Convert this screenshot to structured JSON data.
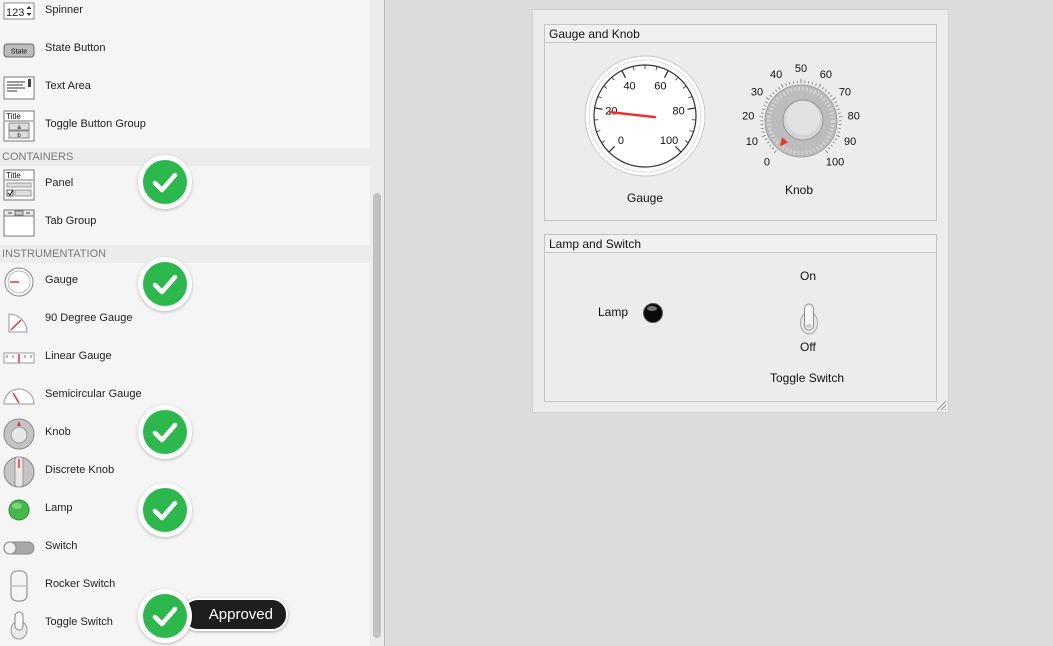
{
  "library": {
    "items_top": [
      {
        "label": "Spinner",
        "icon": "spinner-icon",
        "icon_text": "123"
      },
      {
        "label": "State Button",
        "icon": "state-button-icon",
        "icon_text": "State"
      },
      {
        "label": "Text Area",
        "icon": "text-area-icon"
      },
      {
        "label": "Toggle Button Group",
        "icon": "toggle-button-group-icon",
        "icon_text": "Title",
        "icon_sub_a": "a",
        "icon_sub_b": "b"
      }
    ],
    "containers_header": "CONTAINERS",
    "containers": [
      {
        "label": "Panel",
        "icon": "panel-icon",
        "icon_text": "Title",
        "approved": true
      },
      {
        "label": "Tab Group",
        "icon": "tab-group-icon",
        "approved": false
      }
    ],
    "instrumentation_header": "INSTRUMENTATION",
    "instrumentation": [
      {
        "label": "Gauge",
        "icon": "gauge-icon",
        "approved": true
      },
      {
        "label": "90 Degree Gauge",
        "icon": "ninety-degree-gauge-icon",
        "approved": false
      },
      {
        "label": "Linear Gauge",
        "icon": "linear-gauge-icon",
        "approved": false
      },
      {
        "label": "Semicircular Gauge",
        "icon": "semicircular-gauge-icon",
        "approved": false
      },
      {
        "label": "Knob",
        "icon": "knob-icon",
        "approved": true
      },
      {
        "label": "Discrete Knob",
        "icon": "discrete-knob-icon",
        "approved": false
      },
      {
        "label": "Lamp",
        "icon": "lamp-icon",
        "approved": true
      },
      {
        "label": "Switch",
        "icon": "switch-icon",
        "approved": false
      },
      {
        "label": "Rocker Switch",
        "icon": "rocker-switch-icon",
        "approved": false
      },
      {
        "label": "Toggle Switch",
        "icon": "toggle-switch-icon",
        "approved": true
      }
    ],
    "approved_tooltip": "Approved"
  },
  "canvas": {
    "panel_gauge_knob": {
      "title": "Gauge and Knob",
      "gauge_label": "Gauge",
      "gauge_ticks": [
        "0",
        "20",
        "40",
        "60",
        "80",
        "100"
      ],
      "gauge_value": 19,
      "knob_label": "Knob",
      "knob_ticks": [
        "0",
        "10",
        "20",
        "30",
        "40",
        "50",
        "60",
        "70",
        "80",
        "90",
        "100"
      ],
      "knob_value": 0
    },
    "panel_lamp_switch": {
      "title": "Lamp and Switch",
      "lamp_label": "Lamp",
      "lamp_state": "off",
      "switch_on_label": "On",
      "switch_off_label": "Off",
      "switch_label": "Toggle Switch",
      "switch_state": "off"
    }
  },
  "colors": {
    "approved_green": "#2db84d",
    "needle_red": "#e8372a",
    "lamp_green": "#44b84a"
  }
}
